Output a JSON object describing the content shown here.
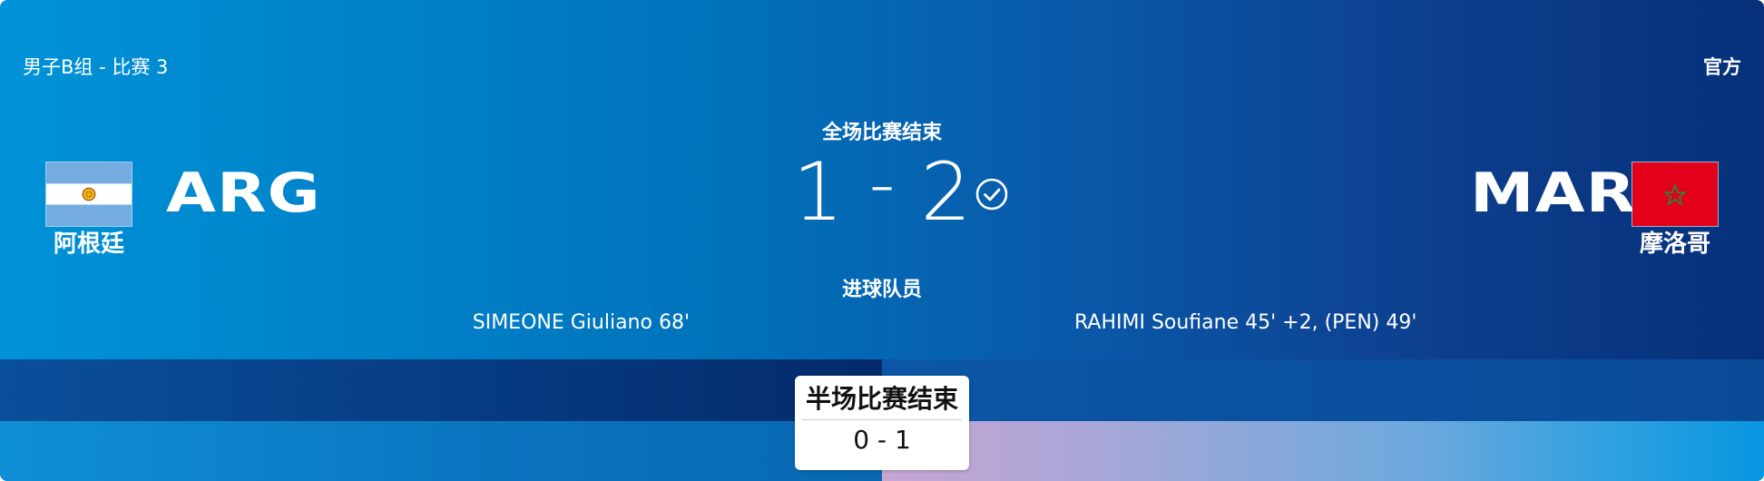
{
  "match": {
    "group_label": "男子B组 - 比赛 3",
    "official_label": "官方",
    "status": "全场比赛结束",
    "home": {
      "code": "ARG",
      "name": "阿根廷",
      "score": "1",
      "scorers": "SIMEONE Giuliano 68'"
    },
    "away": {
      "code": "MAR",
      "name": "摩洛哥",
      "score": "2",
      "scorers": "RAHIMI Soufiane 45' +2, (PEN) 49'"
    },
    "score_separator": "-",
    "verified_icon": "check-circle-icon",
    "scorers_label": "进球队员",
    "half_time": {
      "label": "半场比赛结束",
      "score": "0 - 1"
    }
  },
  "colors": {
    "background_start": "#0092d8",
    "background_end": "#06307a",
    "text": "#ffffff",
    "argentina_sky_blue": "#74acdf",
    "argentina_sun": "#f6b40e",
    "morocco_red": "#e2001a",
    "morocco_star_green": "#3a7a3a"
  }
}
